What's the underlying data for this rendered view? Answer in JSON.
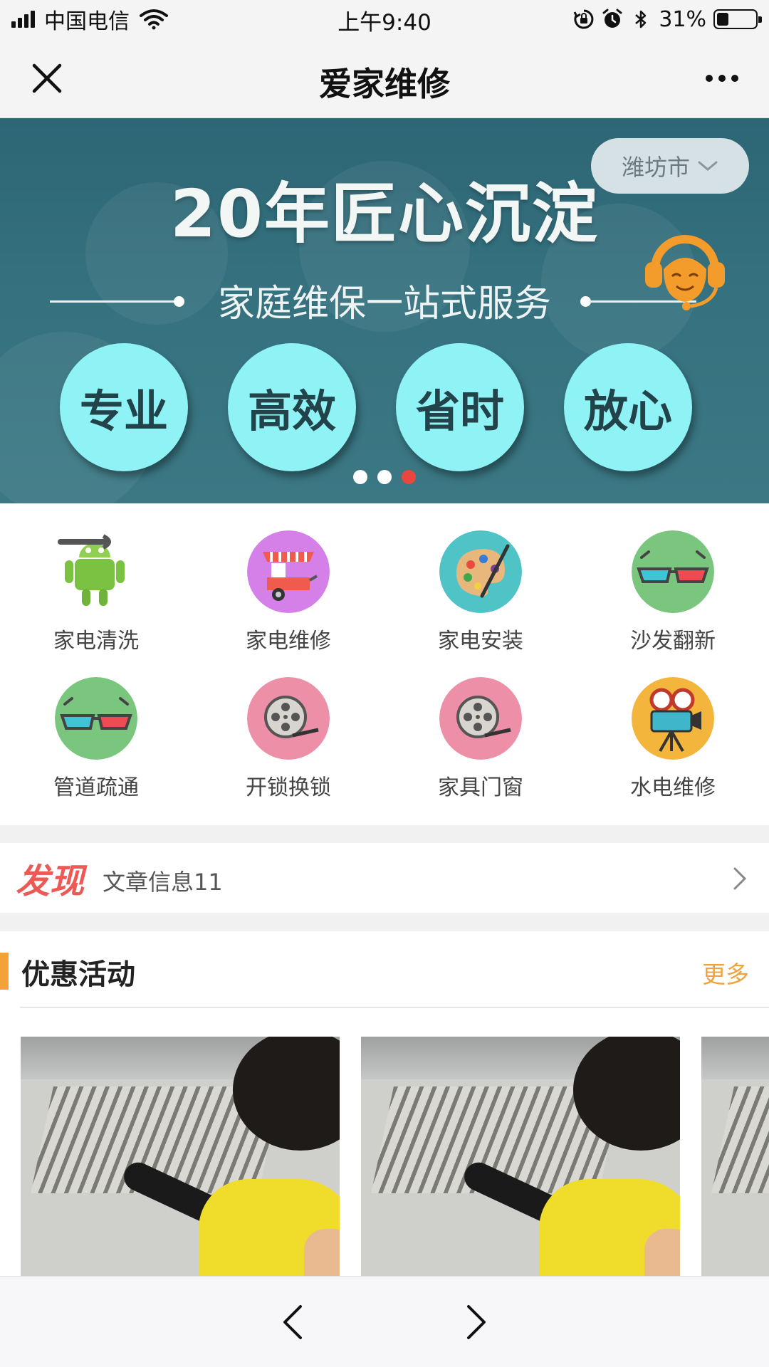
{
  "status_bar": {
    "carrier": "中国电信",
    "time": "上午9:40",
    "battery": "31%",
    "battery_level": 0.31,
    "icons": [
      "signal-icon",
      "wifi-icon",
      "orientation-lock-icon",
      "alarm-icon",
      "bluetooth-icon",
      "battery-icon"
    ]
  },
  "nav": {
    "title": "爱家维修",
    "close_icon": "close-icon",
    "more_icon": "more-icon"
  },
  "banner": {
    "city": "潍坊市",
    "headline": "20年匠心沉淀",
    "subtitle": "家庭维保一站式服务",
    "tags": [
      "专业",
      "高效",
      "省时",
      "放心"
    ],
    "slide_count": 3,
    "active_slide": 3,
    "colors": {
      "circle": "#8ff3f5",
      "active_dot": "#e8463e"
    }
  },
  "services": [
    {
      "label": "家电清洗",
      "icon": "android-wrench-icon"
    },
    {
      "label": "家电维修",
      "icon": "food-cart-icon"
    },
    {
      "label": "家电安装",
      "icon": "palette-icon"
    },
    {
      "label": "沙发翻新",
      "icon": "3d-glasses-icon"
    },
    {
      "label": "管道疏通",
      "icon": "3d-glasses-icon"
    },
    {
      "label": "开锁换锁",
      "icon": "film-reel-icon"
    },
    {
      "label": "家具门窗",
      "icon": "film-reel-icon"
    },
    {
      "label": "水电维修",
      "icon": "movie-camera-icon"
    }
  ],
  "discover": {
    "title": "发现",
    "text": "文章信息11"
  },
  "promo": {
    "title": "优惠活动",
    "more": "更多",
    "accent": "#f3a23a"
  },
  "toolbar": {
    "back_icon": "chevron-left-icon",
    "forward_icon": "chevron-right-icon"
  }
}
